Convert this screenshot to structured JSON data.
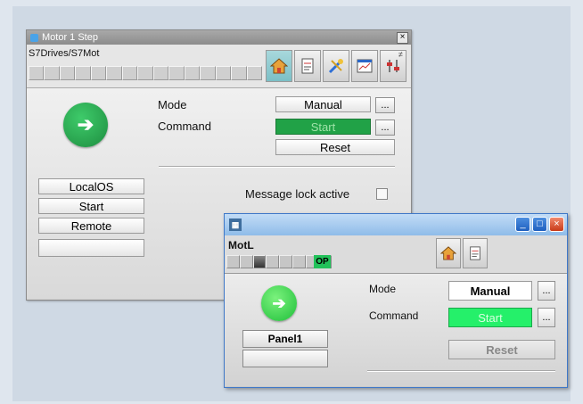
{
  "window1": {
    "title": "Motor 1 Step",
    "close_label": "×",
    "path": "S7Drives/S7Mot",
    "mode_label": "Mode",
    "mode_value": "Manual",
    "command_label": "Command",
    "command_value": "Start",
    "reset_label": "Reset",
    "more_label": "...",
    "buttons": [
      "LocalOS",
      "Start",
      "Remote"
    ],
    "message_lock_label": "Message lock active",
    "tabs": [
      "home-icon",
      "faceplate-icon",
      "tools-icon",
      "trend-icon",
      "parameter-icon"
    ]
  },
  "window2": {
    "name": "MotL",
    "op_badge": "OP",
    "mode_label": "Mode",
    "mode_value": "Manual",
    "command_label": "Command",
    "command_value": "Start",
    "reset_label": "Reset",
    "more_label": "...",
    "panel_label": "Panel1",
    "title_buttons": [
      "_",
      "□",
      "×"
    ],
    "tabs": [
      "home-icon",
      "faceplate-icon"
    ]
  },
  "colors": {
    "running_green_dark": "#21a247",
    "running_green_bright": "#25f06a",
    "titlebar_blue": "#8fbce9"
  }
}
